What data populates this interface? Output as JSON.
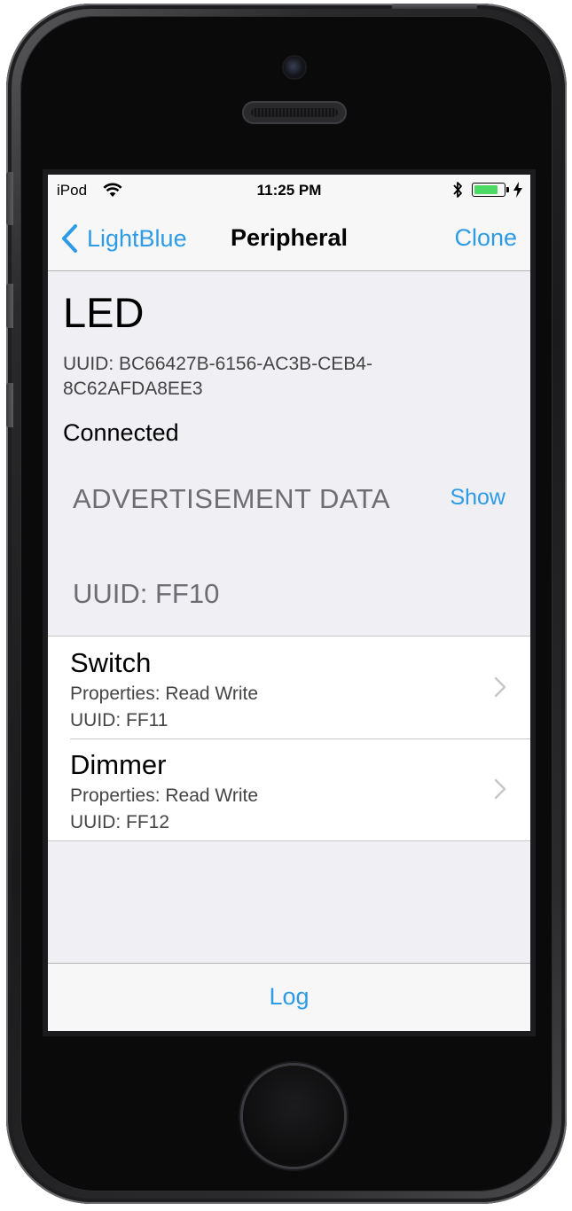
{
  "status_bar": {
    "carrier": "iPod",
    "time": "11:25 PM",
    "battery_level": 0.85,
    "icons": [
      "wifi-icon",
      "bluetooth-icon",
      "battery-icon",
      "charging-icon"
    ]
  },
  "navbar": {
    "back_label": "LightBlue",
    "title": "Peripheral",
    "action_label": "Clone"
  },
  "peripheral": {
    "name": "LED",
    "uuid": "UUID: BC66427B-6156-AC3B-CEB4-8C62AFDA8EE3",
    "status": "Connected"
  },
  "advertisement": {
    "title": "ADVERTISEMENT DATA",
    "show_label": "Show"
  },
  "service": {
    "uuid": "UUID: FF10",
    "characteristics": [
      {
        "name": "Switch",
        "properties": "Properties: Read Write",
        "uuid": "UUID: FF11"
      },
      {
        "name": "Dimmer",
        "properties": "Properties: Read Write",
        "uuid": "UUID: FF12"
      }
    ]
  },
  "toolbar": {
    "log_label": "Log"
  },
  "colors": {
    "accent": "#2d9be5",
    "background": "#efeff4",
    "battery": "#4cd964"
  }
}
